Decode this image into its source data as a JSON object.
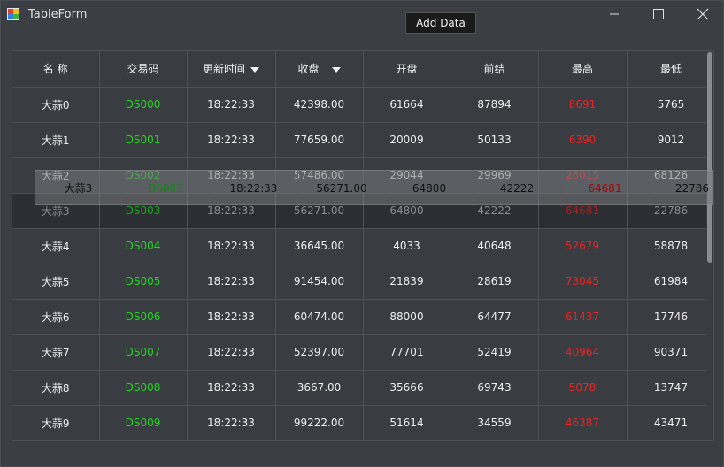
{
  "window": {
    "title": "TableForm"
  },
  "toolbar": {
    "add_label": "Add Data"
  },
  "table": {
    "columns": [
      "名 称",
      "交易码",
      "更新时间",
      "收盘",
      "开盘",
      "前结",
      "最高",
      "最低"
    ],
    "sortable_columns": [
      2,
      3
    ],
    "rows": [
      [
        "大蒜0",
        "DS000",
        "18:22:33",
        "42398.00",
        "61664",
        "87894",
        "8691",
        "5765"
      ],
      [
        "大蒜1",
        "DS001",
        "18:22:33",
        "77659.00",
        "20009",
        "50133",
        "6390",
        "9012"
      ],
      [
        "大蒜2",
        "DS002",
        "18:22:33",
        "57486.00",
        "29044",
        "29969",
        "26015",
        "68126"
      ],
      [
        "大蒜3",
        "DS003",
        "18:22:33",
        "56271.00",
        "64800",
        "42222",
        "64681",
        "22786"
      ],
      [
        "大蒜4",
        "DS004",
        "18:22:33",
        "36645.00",
        "4033",
        "40648",
        "52679",
        "58878"
      ],
      [
        "大蒜5",
        "DS005",
        "18:22:33",
        "91454.00",
        "21839",
        "28619",
        "73045",
        "61984"
      ],
      [
        "大蒜6",
        "DS006",
        "18:22:33",
        "60474.00",
        "88000",
        "64477",
        "61437",
        "17746"
      ],
      [
        "大蒜7",
        "DS007",
        "18:22:33",
        "52397.00",
        "77701",
        "52419",
        "40964",
        "90371"
      ],
      [
        "大蒜8",
        "DS008",
        "18:22:33",
        "3667.00",
        "35666",
        "69743",
        "5078",
        "13747"
      ],
      [
        "大蒜9",
        "DS009",
        "18:22:33",
        "99222.00",
        "51614",
        "34559",
        "46387",
        "43471"
      ]
    ],
    "selected_row": 1,
    "dragged_row": 3
  },
  "drag_ghost": {
    "cells": [
      "大蒜3",
      "DS003",
      "18:22:33",
      "56271.00",
      "64800",
      "42222",
      "64681",
      "22786"
    ]
  },
  "colors": {
    "code": "#22d622",
    "high": "#ee2222"
  }
}
